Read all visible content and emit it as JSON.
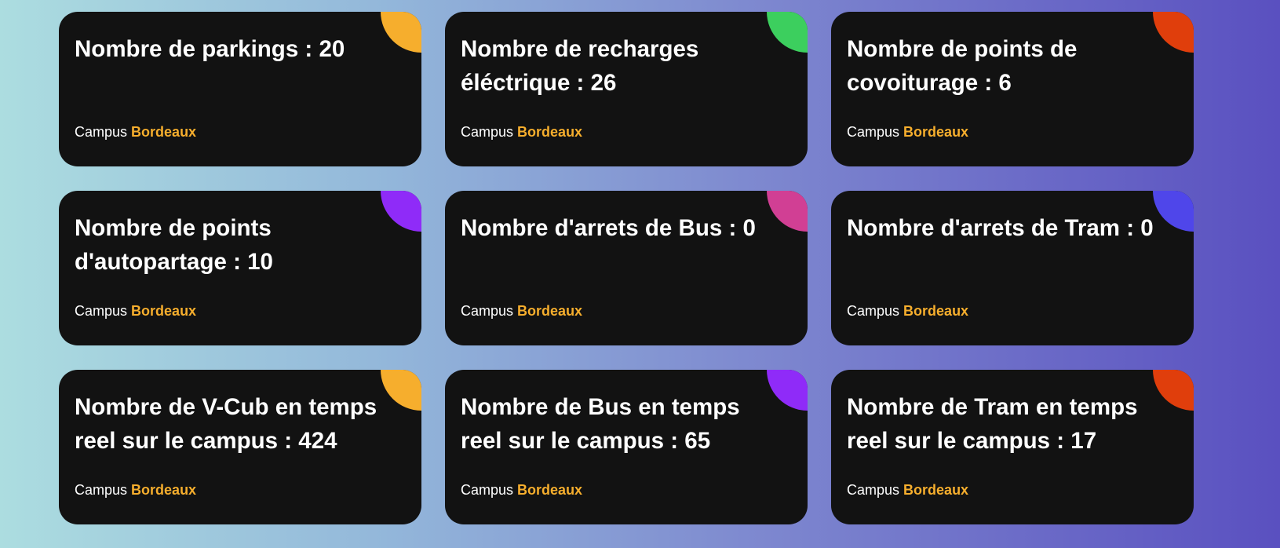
{
  "cards": [
    {
      "title": "Nombre de parkings : 20",
      "campus_label": "Campus",
      "campus_name": "Bordeaux",
      "accent": "#f6ae2d"
    },
    {
      "title": "Nombre de recharges éléctrique : 26",
      "campus_label": "Campus",
      "campus_name": "Bordeaux",
      "accent": "#3ccf5e"
    },
    {
      "title": "Nombre de points de covoiturage : 6",
      "campus_label": "Campus",
      "campus_name": "Bordeaux",
      "accent": "#e03e0c"
    },
    {
      "title": "Nombre de points d'autopartage : 10",
      "campus_label": "Campus",
      "campus_name": "Bordeaux",
      "accent": "#8f2bf8"
    },
    {
      "title": "Nombre d'arrets de Bus : 0",
      "campus_label": "Campus",
      "campus_name": "Bordeaux",
      "accent": "#d13f94"
    },
    {
      "title": "Nombre d'arrets de Tram : 0",
      "campus_label": "Campus",
      "campus_name": "Bordeaux",
      "accent": "#4f46ea"
    },
    {
      "title": "Nombre de V-Cub en temps reel sur le campus : 424",
      "campus_label": "Campus",
      "campus_name": "Bordeaux",
      "accent": "#f6ae2d"
    },
    {
      "title": "Nombre de Bus en temps reel sur le campus : 65",
      "campus_label": "Campus",
      "campus_name": "Bordeaux",
      "accent": "#8f2bf8"
    },
    {
      "title": "Nombre de Tram en temps reel sur le campus : 17",
      "campus_label": "Campus",
      "campus_name": "Bordeaux",
      "accent": "#e03e0c"
    }
  ]
}
